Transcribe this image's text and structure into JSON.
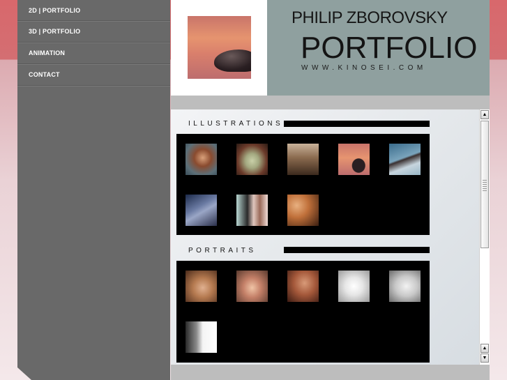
{
  "nav": {
    "items": [
      {
        "label": "2D | PORTFOLIO"
      },
      {
        "label": "3D | PORTFOLIO"
      },
      {
        "label": "ANIMATION"
      },
      {
        "label": "CONTACT"
      }
    ]
  },
  "header": {
    "name": "PHILIP ZBOROVSKY",
    "title": "PORTFOLIO",
    "url": "WWW.KINOSEI.COM"
  },
  "sections": [
    {
      "label": "ILLUSTRATIONS"
    },
    {
      "label": "PORTRAITS"
    }
  ],
  "colors": {
    "sidebar": "#696969",
    "header_panel": "#8fa09f",
    "thumb_panel": "#000000",
    "page_top": "#d8686c"
  },
  "icons": {
    "scroll_up": "scroll-up-arrow-icon",
    "scroll_down": "scroll-down-arrow-icon"
  }
}
